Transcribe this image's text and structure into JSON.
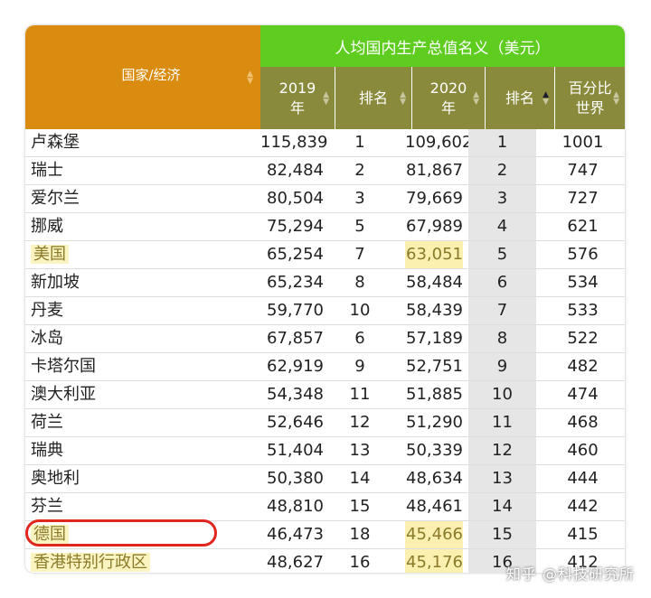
{
  "header": {
    "country_col": "国家/经济",
    "group_title": "人均国内生产总值名义（美元）",
    "col_2019_line1": "2019",
    "col_2019_line2": "年",
    "col_rank1": "排名",
    "col_2020_line1": "2020",
    "col_2020_line2": "年",
    "col_rank2": "排名",
    "col_pct_line1": "百分比",
    "col_pct_line2": "世界"
  },
  "rows": [
    {
      "name": "卢森堡",
      "v2019": "115,839",
      "r2019": "1",
      "v2020": "109,602",
      "r2020": "1",
      "pct": "1001"
    },
    {
      "name": "瑞士",
      "v2019": "82,484",
      "r2019": "2",
      "v2020": "81,867",
      "r2020": "2",
      "pct": "747"
    },
    {
      "name": "爱尔兰",
      "v2019": "80,504",
      "r2019": "3",
      "v2020": "79,669",
      "r2020": "3",
      "pct": "727"
    },
    {
      "name": "挪威",
      "v2019": "75,294",
      "r2019": "5",
      "v2020": "67,989",
      "r2020": "4",
      "pct": "621"
    },
    {
      "name": "美国",
      "v2019": "65,254",
      "r2019": "7",
      "v2020": "63,051",
      "r2020": "5",
      "pct": "576"
    },
    {
      "name": "新加坡",
      "v2019": "65,234",
      "r2019": "8",
      "v2020": "58,484",
      "r2020": "6",
      "pct": "534"
    },
    {
      "name": "丹麦",
      "v2019": "59,770",
      "r2019": "10",
      "v2020": "58,439",
      "r2020": "7",
      "pct": "533"
    },
    {
      "name": "冰岛",
      "v2019": "67,857",
      "r2019": "6",
      "v2020": "57,189",
      "r2020": "8",
      "pct": "522"
    },
    {
      "name": "卡塔尔国",
      "v2019": "62,919",
      "r2019": "9",
      "v2020": "52,751",
      "r2020": "9",
      "pct": "482"
    },
    {
      "name": "澳大利亚",
      "v2019": "54,348",
      "r2019": "11",
      "v2020": "51,885",
      "r2020": "10",
      "pct": "474"
    },
    {
      "name": "荷兰",
      "v2019": "52,646",
      "r2019": "12",
      "v2020": "51,290",
      "r2020": "11",
      "pct": "468"
    },
    {
      "name": "瑞典",
      "v2019": "51,404",
      "r2019": "13",
      "v2020": "50,339",
      "r2020": "12",
      "pct": "460"
    },
    {
      "name": "奥地利",
      "v2019": "50,380",
      "r2019": "14",
      "v2020": "48,634",
      "r2020": "13",
      "pct": "444"
    },
    {
      "name": "芬兰",
      "v2019": "48,810",
      "r2019": "15",
      "v2020": "48,461",
      "r2020": "14",
      "pct": "442"
    },
    {
      "name": "德国",
      "v2019": "46,473",
      "r2019": "18",
      "v2020": "45,466",
      "r2020": "15",
      "pct": "415"
    },
    {
      "name": "香港特别行政区",
      "v2019": "48,627",
      "r2019": "16",
      "v2020": "45,176",
      "r2020": "16",
      "pct": "412"
    }
  ],
  "watermark": "知乎 @科技研究所",
  "colors": {
    "country_header": "#d98c0f",
    "group_header": "#5fcc20",
    "sub_header": "#8a8a3c",
    "highlight": "#fbf0b0",
    "circle": "#e0261e"
  }
}
